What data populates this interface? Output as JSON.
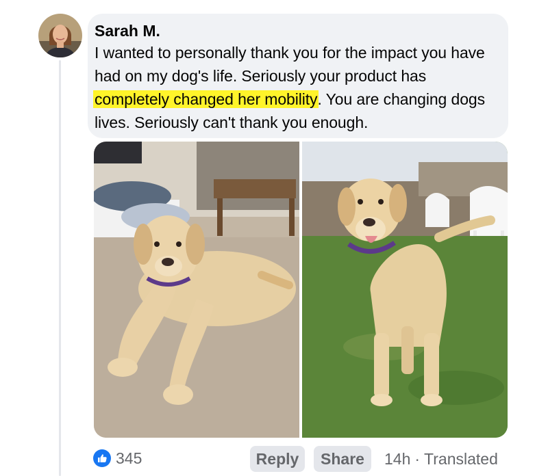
{
  "comment": {
    "author": "Sarah M.",
    "text_before": "I wanted to personally thank you for the impact you have had on my dog's life. Seriously your product has ",
    "text_highlight": "completely changed her mobility",
    "text_after": ". You are changing dogs lives. Seriously can't thank you enough."
  },
  "photos": [
    {
      "icon": "dog-lying-indoors-photo"
    },
    {
      "icon": "dog-standing-outdoors-photo"
    }
  ],
  "footer": {
    "like_count": "345",
    "reply_label": "Reply",
    "share_label": "Share",
    "time": "14h",
    "separator": "·",
    "translated": "Translated"
  },
  "colors": {
    "highlight": "#fff42a",
    "like_blue": "#1877f2",
    "bubble_bg": "#f0f2f5"
  }
}
